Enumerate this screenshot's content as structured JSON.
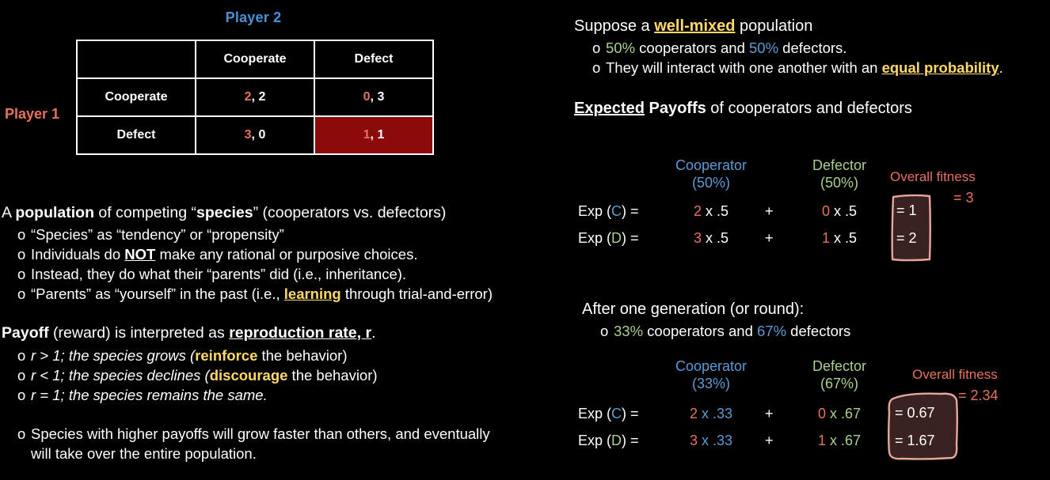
{
  "matrix": {
    "player2_label": "Player 2",
    "player1_label": "Player 1",
    "col_headers": [
      "",
      "Cooperate",
      "Defect"
    ],
    "rows": [
      {
        "label": "Cooperate",
        "cells": [
          {
            "p1": "2",
            "p2": "2"
          },
          {
            "p1": "0",
            "p2": "3"
          }
        ]
      },
      {
        "label": "Defect",
        "cells": [
          {
            "p1": "3",
            "p2": "0"
          },
          {
            "p1": "1",
            "p2": "1"
          }
        ]
      }
    ],
    "highlight_cell": "Defect / Defect",
    "highlight_color": "#8b0a0a"
  },
  "left": {
    "para1": {
      "prefix": "A ",
      "bold1": "population",
      "mid1": " of competing “",
      "bold2": "species",
      "suffix": "” (cooperators vs. defectors)"
    },
    "bullets1": [
      {
        "text": "“Species” as “tendency” or “propensity”"
      },
      {
        "pre": "Individuals do ",
        "hi": "NOT",
        "post": " make any rational or purposive choices."
      },
      {
        "text": "Instead, they do what their “parents” did (i.e., inheritance)."
      },
      {
        "pre": "“Parents” as “yourself” in the past (i.e., ",
        "hi": "learning",
        "post": " through trial-and-error)"
      }
    ],
    "para2": {
      "bold1": "Payoff",
      "mid1": " (reward) is interpreted as ",
      "bold2": "reproduction rate, r",
      "suffix": "."
    },
    "bullets2": [
      {
        "pre": "r > 1; the species grows (",
        "hi": "reinforce",
        "post": " the behavior)"
      },
      {
        "pre": "r < 1; the species declines (",
        "hi": "discourage",
        "post": " the behavior)"
      },
      {
        "text": "r = 1; the species remains the same."
      }
    ],
    "bullet_final_line1": "Species with higher payoffs will grow faster than others, and eventually",
    "bullet_final_line2": "will take over the entire population."
  },
  "right": {
    "heading1": {
      "pre": "Suppose a ",
      "hi": "well-mixed",
      "post": " population"
    },
    "bullet_a": {
      "pct1": "50%",
      "mid": " cooperators and ",
      "pct2": "50%",
      "post": " defectors."
    },
    "bullet_b": {
      "pre": "They will interact with one another with an ",
      "hi": "equal probability",
      "post": "."
    },
    "heading2": {
      "hi": "Expected",
      "bold": " Payoffs",
      "post": " of cooperators and defectors"
    },
    "heading3": "After one generation (or round):",
    "bullet_c": {
      "pct1": "33%",
      "mid": " cooperators and ",
      "pct2": "67%",
      "post": " defectors"
    }
  },
  "chart_data": [
    {
      "type": "table",
      "title": "Expected Payoffs (50/50 mix)",
      "col_headers": [
        "Cooperator",
        "Defector"
      ],
      "col_subheaders": [
        "(50%)",
        "(50%)"
      ],
      "row_labels": [
        "Exp (C) =",
        "Exp (D) ="
      ],
      "operator": "+",
      "terms": [
        [
          {
            "payoff": "2",
            "prob": "x .5"
          },
          {
            "payoff": "0",
            "prob": "x .5"
          }
        ],
        [
          {
            "payoff": "3",
            "prob": "x .5"
          },
          {
            "payoff": "1",
            "prob": "x .5"
          }
        ]
      ],
      "results": [
        "= 1",
        "= 2"
      ],
      "fitness_label": "Overall fitness",
      "fitness_total": "= 3"
    },
    {
      "type": "table",
      "title": "Expected Payoffs (33/67 mix)",
      "col_headers": [
        "Cooperator",
        "Defector"
      ],
      "col_subheaders": [
        "(33%)",
        "(67%)"
      ],
      "row_labels": [
        "Exp (C) =",
        "Exp (D) ="
      ],
      "operator": "+",
      "terms": [
        [
          {
            "payoff": "2",
            "prob": "x .33"
          },
          {
            "payoff": "0",
            "prob": "x .67"
          }
        ],
        [
          {
            "payoff": "3",
            "prob": "x .33"
          },
          {
            "payoff": "1",
            "prob": "x .67"
          }
        ]
      ],
      "results": [
        "= 0.67",
        "= 1.67"
      ],
      "fitness_label": "Overall fitness",
      "fitness_total": "= 2.34"
    }
  ],
  "colors": {
    "cooperator": "#5b9bd5",
    "defector": "#a9d18e",
    "player1": "#e8715f",
    "player2": "#4a90d9",
    "highlight_gold": "#ffd966",
    "annotation": "#e8a79c",
    "background": "#000000"
  }
}
